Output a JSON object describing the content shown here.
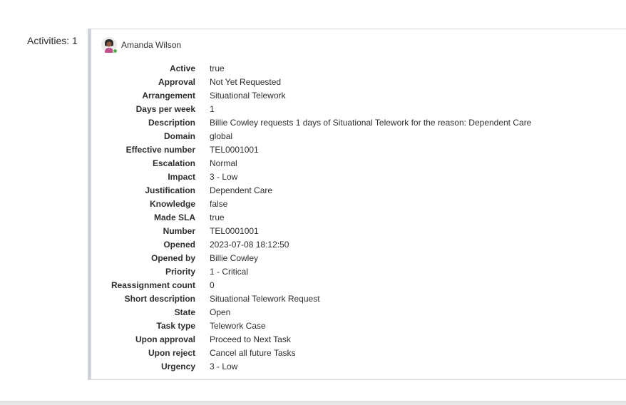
{
  "activities": {
    "label": "Activities: 1"
  },
  "activity": {
    "author": "Amanda Wilson",
    "fields": [
      {
        "label": "Active",
        "value": "true"
      },
      {
        "label": "Approval",
        "value": "Not Yet Requested"
      },
      {
        "label": "Arrangement",
        "value": "Situational Telework"
      },
      {
        "label": "Days per week",
        "value": "1"
      },
      {
        "label": "Description",
        "value": "Billie Cowley requests 1 days of Situational Telework for the reason: Dependent Care"
      },
      {
        "label": "Domain",
        "value": "global"
      },
      {
        "label": "Effective number",
        "value": "TEL0001001"
      },
      {
        "label": "Escalation",
        "value": "Normal"
      },
      {
        "label": "Impact",
        "value": "3 - Low"
      },
      {
        "label": "Justification",
        "value": "Dependent Care"
      },
      {
        "label": "Knowledge",
        "value": "false"
      },
      {
        "label": "Made SLA",
        "value": "true"
      },
      {
        "label": "Number",
        "value": "TEL0001001"
      },
      {
        "label": "Opened",
        "value": "2023-07-08 18:12:50"
      },
      {
        "label": "Opened by",
        "value": "Billie Cowley"
      },
      {
        "label": "Priority",
        "value": "1 - Critical"
      },
      {
        "label": "Reassignment count",
        "value": "0"
      },
      {
        "label": "Short description",
        "value": "Situational Telework Request"
      },
      {
        "label": "State",
        "value": "Open"
      },
      {
        "label": "Task type",
        "value": "Telework Case"
      },
      {
        "label": "Upon approval",
        "value": "Proceed to Next Task"
      },
      {
        "label": "Upon reject",
        "value": "Cancel all future Tasks"
      },
      {
        "label": "Urgency",
        "value": "3 - Low"
      }
    ]
  },
  "colors": {
    "presence": "#4caf50",
    "card_border": "#d9d9d9",
    "card_accent": "#cfd3d7"
  },
  "icons": {
    "avatar": "user-avatar-icon",
    "presence": "online-presence-icon"
  }
}
